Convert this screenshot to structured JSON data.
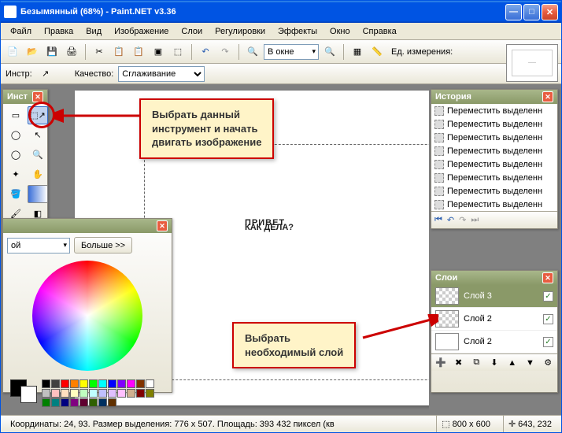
{
  "window": {
    "title": "Безымянный (68%) - Paint.NET v3.36"
  },
  "menu": [
    "Файл",
    "Правка",
    "Вид",
    "Изображение",
    "Слои",
    "Регулировки",
    "Эффекты",
    "Окно",
    "Справка"
  ],
  "toolbar": {
    "zoom_mode": "В окне",
    "units_label": "Ед. измерения:"
  },
  "toolbar2": {
    "instr_label": "Инстр:",
    "quality_label": "Качество:",
    "quality_value": "Сглаживание"
  },
  "panels": {
    "tools_title": "Инст",
    "colors_title": "",
    "colors_layer_label": "ой",
    "more_button": "Больше >>",
    "history_title": "История",
    "history_items": [
      "Переместить выделенн",
      "Переместить выделенн",
      "Переместить выделенн",
      "Переместить выделенн",
      "Переместить выделенн",
      "Переместить выделенн",
      "Переместить выделенн",
      "Переместить выделенн"
    ],
    "layers_title": "Слои",
    "layers": [
      {
        "name": "Слой 3",
        "checker": true,
        "sel": true
      },
      {
        "name": "Слой 2",
        "checker": true,
        "sel": false
      },
      {
        "name": "Слой 2",
        "checker": false,
        "sel": false
      }
    ]
  },
  "canvas": {
    "line1": "ПРИВЕТ",
    "line2": "КАК ДЕЛА?"
  },
  "callouts": {
    "top": "Выбрать данный\nинструмент и начать\nдвигать изображение",
    "bottom": "Выбрать\nнеобходимый слой"
  },
  "status": {
    "coords": "Координаты: 24, 93. Размер выделения: 776 x 507. Площадь: 393 432 пиксел (кв",
    "dims": "800 x 600",
    "cursor": "643, 232"
  },
  "swatches_top": [
    "#000",
    "#404040",
    "#f00",
    "#ff8000",
    "#ff0",
    "#0f0",
    "#0ff",
    "#00f",
    "#8000ff",
    "#f0f",
    "#803300",
    "#fff",
    "#c0c0c0",
    "#ffc0c0",
    "#ffe0c0",
    "#ffffc0"
  ],
  "swatches_bot": [
    "#c0ffc0",
    "#c0ffff",
    "#c0c0ff",
    "#e0c0ff",
    "#ffc0ff",
    "#d0b090",
    "#800000",
    "#808000",
    "#008000",
    "#008080",
    "#000080",
    "#800080",
    "#600030",
    "#306000",
    "#003060",
    "#603000"
  ]
}
